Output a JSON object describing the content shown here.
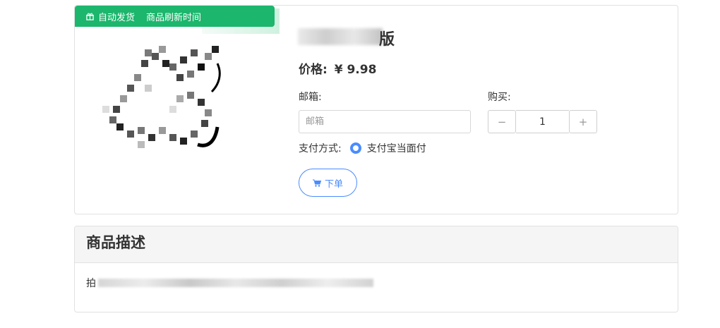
{
  "badge": {
    "auto_ship": "自动发货",
    "refresh": "商品刷新时间"
  },
  "product": {
    "title_suffix": "版",
    "price_label": "价格:",
    "price_value": "¥ 9.98"
  },
  "form": {
    "email_label": "邮箱:",
    "email_placeholder": "邮箱",
    "quantity_label": "购买:",
    "quantity_value": "1",
    "decrement": "−",
    "increment": "+",
    "payment_label": "支付方式:",
    "payment_option": "支付宝当面付",
    "order_button": "下单"
  },
  "description": {
    "title": "商品描述",
    "text_start": "拍"
  },
  "colors": {
    "badge_green": "#1cb66d",
    "accent_blue": "#4a8cff"
  }
}
